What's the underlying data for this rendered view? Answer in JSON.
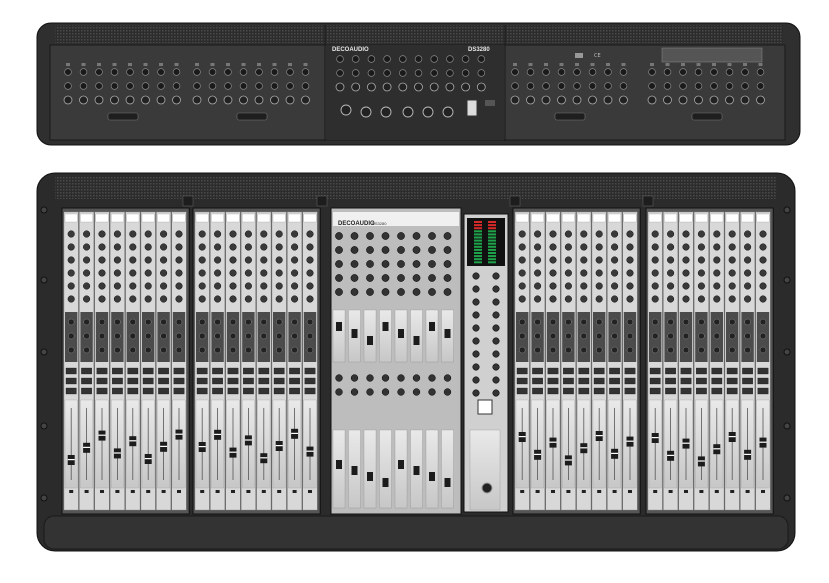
{
  "rear_panel": {
    "brand": "DECOAUDIO",
    "model": "DS3280"
  },
  "front_panel": {
    "brand": "DECOAUDIO",
    "model": "DS3280"
  },
  "colors": {
    "chassis": "#3a3a3a",
    "chassis_dark": "#232323",
    "panel": "#d8d8d8",
    "meter_green": "#1fa34a",
    "meter_red": "#d62a2a"
  }
}
